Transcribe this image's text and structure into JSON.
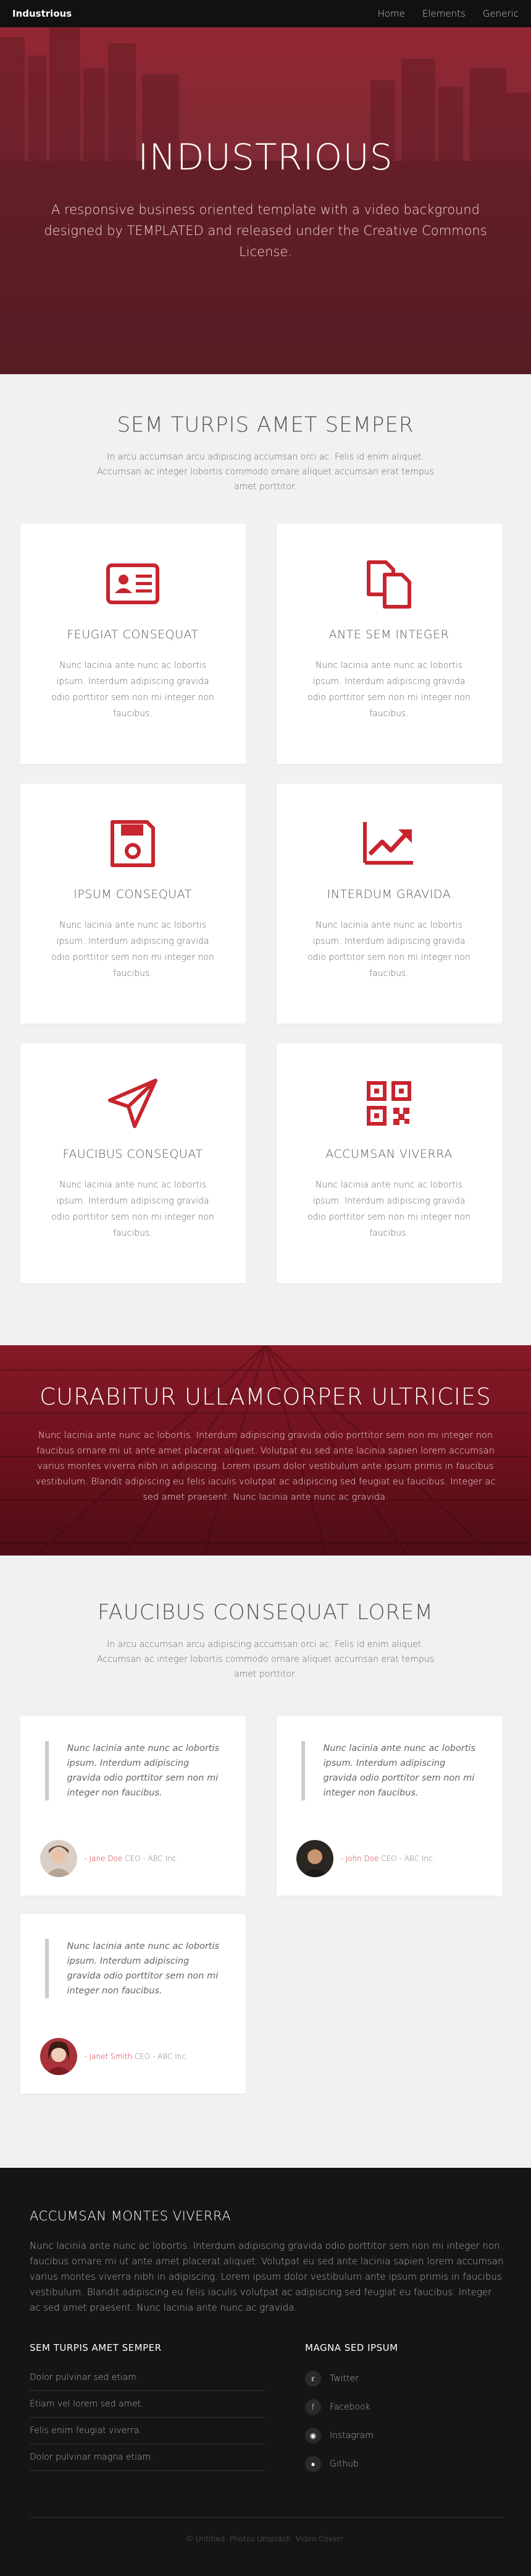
{
  "header": {
    "brand": "Industrious",
    "nav": [
      "Home",
      "Elements",
      "Generic"
    ]
  },
  "banner": {
    "title": "INDUSTRIOUS",
    "text": "A responsive business oriented template with a video background designed by TEMPLATED and released under the Creative Commons License."
  },
  "section1": {
    "title": "SEM TURPIS AMET SEMPER",
    "subtitle": "In arcu accumsan arcu adipiscing accumsan orci ac. Felis id enim aliquet. Accumsan ac integer lobortis commodo ornare aliquet accumsan erat tempus amet porttitor.",
    "cards": [
      {
        "icon": "id-card-icon",
        "title": "FEUGIAT CONSEQUAT",
        "text": "Nunc lacinia ante nunc ac lobortis ipsum. Interdum adipiscing gravida odio porttitor sem non mi integer non faucibus."
      },
      {
        "icon": "files-icon",
        "title": "ANTE SEM INTEGER",
        "text": "Nunc lacinia ante nunc ac lobortis ipsum. Interdum adipiscing gravida odio porttitor sem non mi integer non faucibus."
      },
      {
        "icon": "save-icon",
        "title": "IPSUM CONSEQUAT",
        "text": "Nunc lacinia ante nunc ac lobortis ipsum. Interdum adipiscing gravida odio porttitor sem non mi integer non faucibus."
      },
      {
        "icon": "trend-up-icon",
        "title": "INTERDUM GRAVIDA",
        "text": "Nunc lacinia ante nunc ac lobortis ipsum. Interdum adipiscing gravida odio porttitor sem non mi integer non faucibus."
      },
      {
        "icon": "paper-plane-icon",
        "title": "FAUCIBUS CONSEQUAT",
        "text": "Nunc lacinia ante nunc ac lobortis ipsum. Interdum adipiscing gravida odio porttitor sem non mi integer non faucibus."
      },
      {
        "icon": "qr-code-icon",
        "title": "ACCUMSAN VIVERRA",
        "text": "Nunc lacinia ante nunc ac lobortis ipsum. Interdum adipiscing gravida odio porttitor sem non mi integer non faucibus."
      }
    ]
  },
  "band": {
    "title": "CURABITUR ULLAMCORPER ULTRICIES",
    "text": "Nunc lacinia ante nunc ac lobortis. Interdum adipiscing gravida odio porttitor sem non mi integer non faucibus ornare mi ut ante amet placerat aliquet. Volutpat eu sed ante lacinia sapien lorem accumsan varius montes viverra nibh in adipiscing. Lorem ipsum dolor vestibulum ante ipsum primis in faucibus vestibulum. Blandit adipiscing eu felis iaculis volutpat ac adipiscing sed feugiat eu faucibus. Integer ac sed amet praesent. Nunc lacinia ante nunc ac gravida."
  },
  "section2": {
    "title": "FAUCIBUS CONSEQUAT LOREM",
    "subtitle": "In arcu accumsan arcu adipiscing accumsan orci ac. Felis id enim aliquet. Accumsan ac integer lobortis commodo ornare aliquet accumsan erat tempus amet porttitor.",
    "testimonials": [
      {
        "quote": "Nunc lacinia ante nunc ac lobortis ipsum. Interdum adipiscing gravida odio porttitor sem non mi integer non faucibus.",
        "name": "- Jane Doe",
        "role": "CEO - ABC Inc."
      },
      {
        "quote": "Nunc lacinia ante nunc ac lobortis ipsum. Interdum adipiscing gravida odio porttitor sem non mi integer non faucibus.",
        "name": "- John Doe",
        "role": "CEO - ABC Inc."
      },
      {
        "quote": "Nunc lacinia ante nunc ac lobortis ipsum. Interdum adipiscing gravida odio porttitor sem non mi integer non faucibus.",
        "name": "- Janet Smith",
        "role": "CEO - ABC Inc."
      }
    ]
  },
  "footer": {
    "title": "ACCUMSAN MONTES VIVERRA",
    "about": "Nunc lacinia ante nunc ac lobortis. Interdum adipiscing gravida odio porttitor sem non mi integer non faucibus ornare mi ut ante amet placerat aliquet. Volutpat eu sed ante lacinia sapien lorem accumsan varius montes viverra nibh in adipiscing. Lorem ipsum dolor vestibulum ante ipsum primis in faucibus vestibulum. Blandit adipiscing eu felis iaculis volutpat ac adipiscing sed feugiat eu faucibus. Integer ac sed amet praesent. Nunc lacinia ante nunc ac gravida.",
    "links_title": "SEM TURPIS AMET SEMPER",
    "links": [
      "Dolor pulvinar sed etiam.",
      "Etiam vel lorem sed amet.",
      "Felis enim feugiat viverra.",
      "Dolor pulvinar magna etiam."
    ],
    "social_title": "MAGNA SED IPSUM",
    "social": [
      {
        "icon": "twitter-icon",
        "label": "Twitter"
      },
      {
        "icon": "facebook-icon",
        "label": "Facebook"
      },
      {
        "icon": "instagram-icon",
        "label": "Instagram"
      },
      {
        "icon": "github-icon",
        "label": "Github"
      }
    ],
    "copyright": "© Untitled. Photos Unsplash. Video Coverr."
  },
  "colors": {
    "accent": "#c7252f",
    "dark": "#151515",
    "pale": "#f1f1f1"
  }
}
